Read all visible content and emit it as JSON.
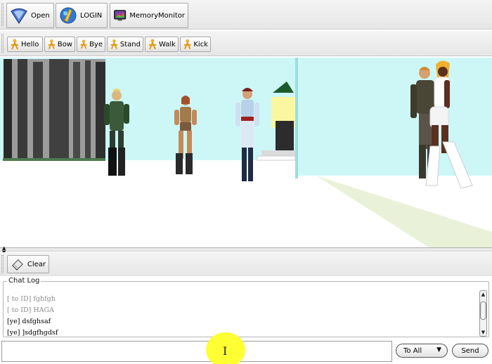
{
  "toolbar_main": {
    "open_label": "Open",
    "login_label": "LOGIN",
    "memory_monitor_label": "MemoryMonitor"
  },
  "toolbar_actions": {
    "items": [
      {
        "label": "Hello",
        "icon": "person-icon"
      },
      {
        "label": "Bow",
        "icon": "person-icon"
      },
      {
        "label": "Bye",
        "icon": "person-icon"
      },
      {
        "label": "Stand",
        "icon": "person-icon"
      },
      {
        "label": "Walk",
        "icon": "person-icon"
      },
      {
        "label": "Kick",
        "icon": "person-icon"
      }
    ]
  },
  "chat_panel": {
    "clear_label": "Clear",
    "chat_log_title": "Chat Log",
    "lines": [
      {
        "text": "[ to ID] fghfgh",
        "style": "old"
      },
      {
        "text": "[ to ID] HAGA",
        "style": "old"
      },
      {
        "text": "[ye] dsfghsaf",
        "style": "new"
      },
      {
        "text": "[ye] ]sdgfhgdsf",
        "style": "new"
      }
    ],
    "input_value": "",
    "recipient_selected": "To All",
    "send_label": "Send"
  },
  "colors": {
    "sky": "#cdf7f7",
    "cursor_highlight": "#ffff33",
    "action_icon": "#f0b030"
  }
}
